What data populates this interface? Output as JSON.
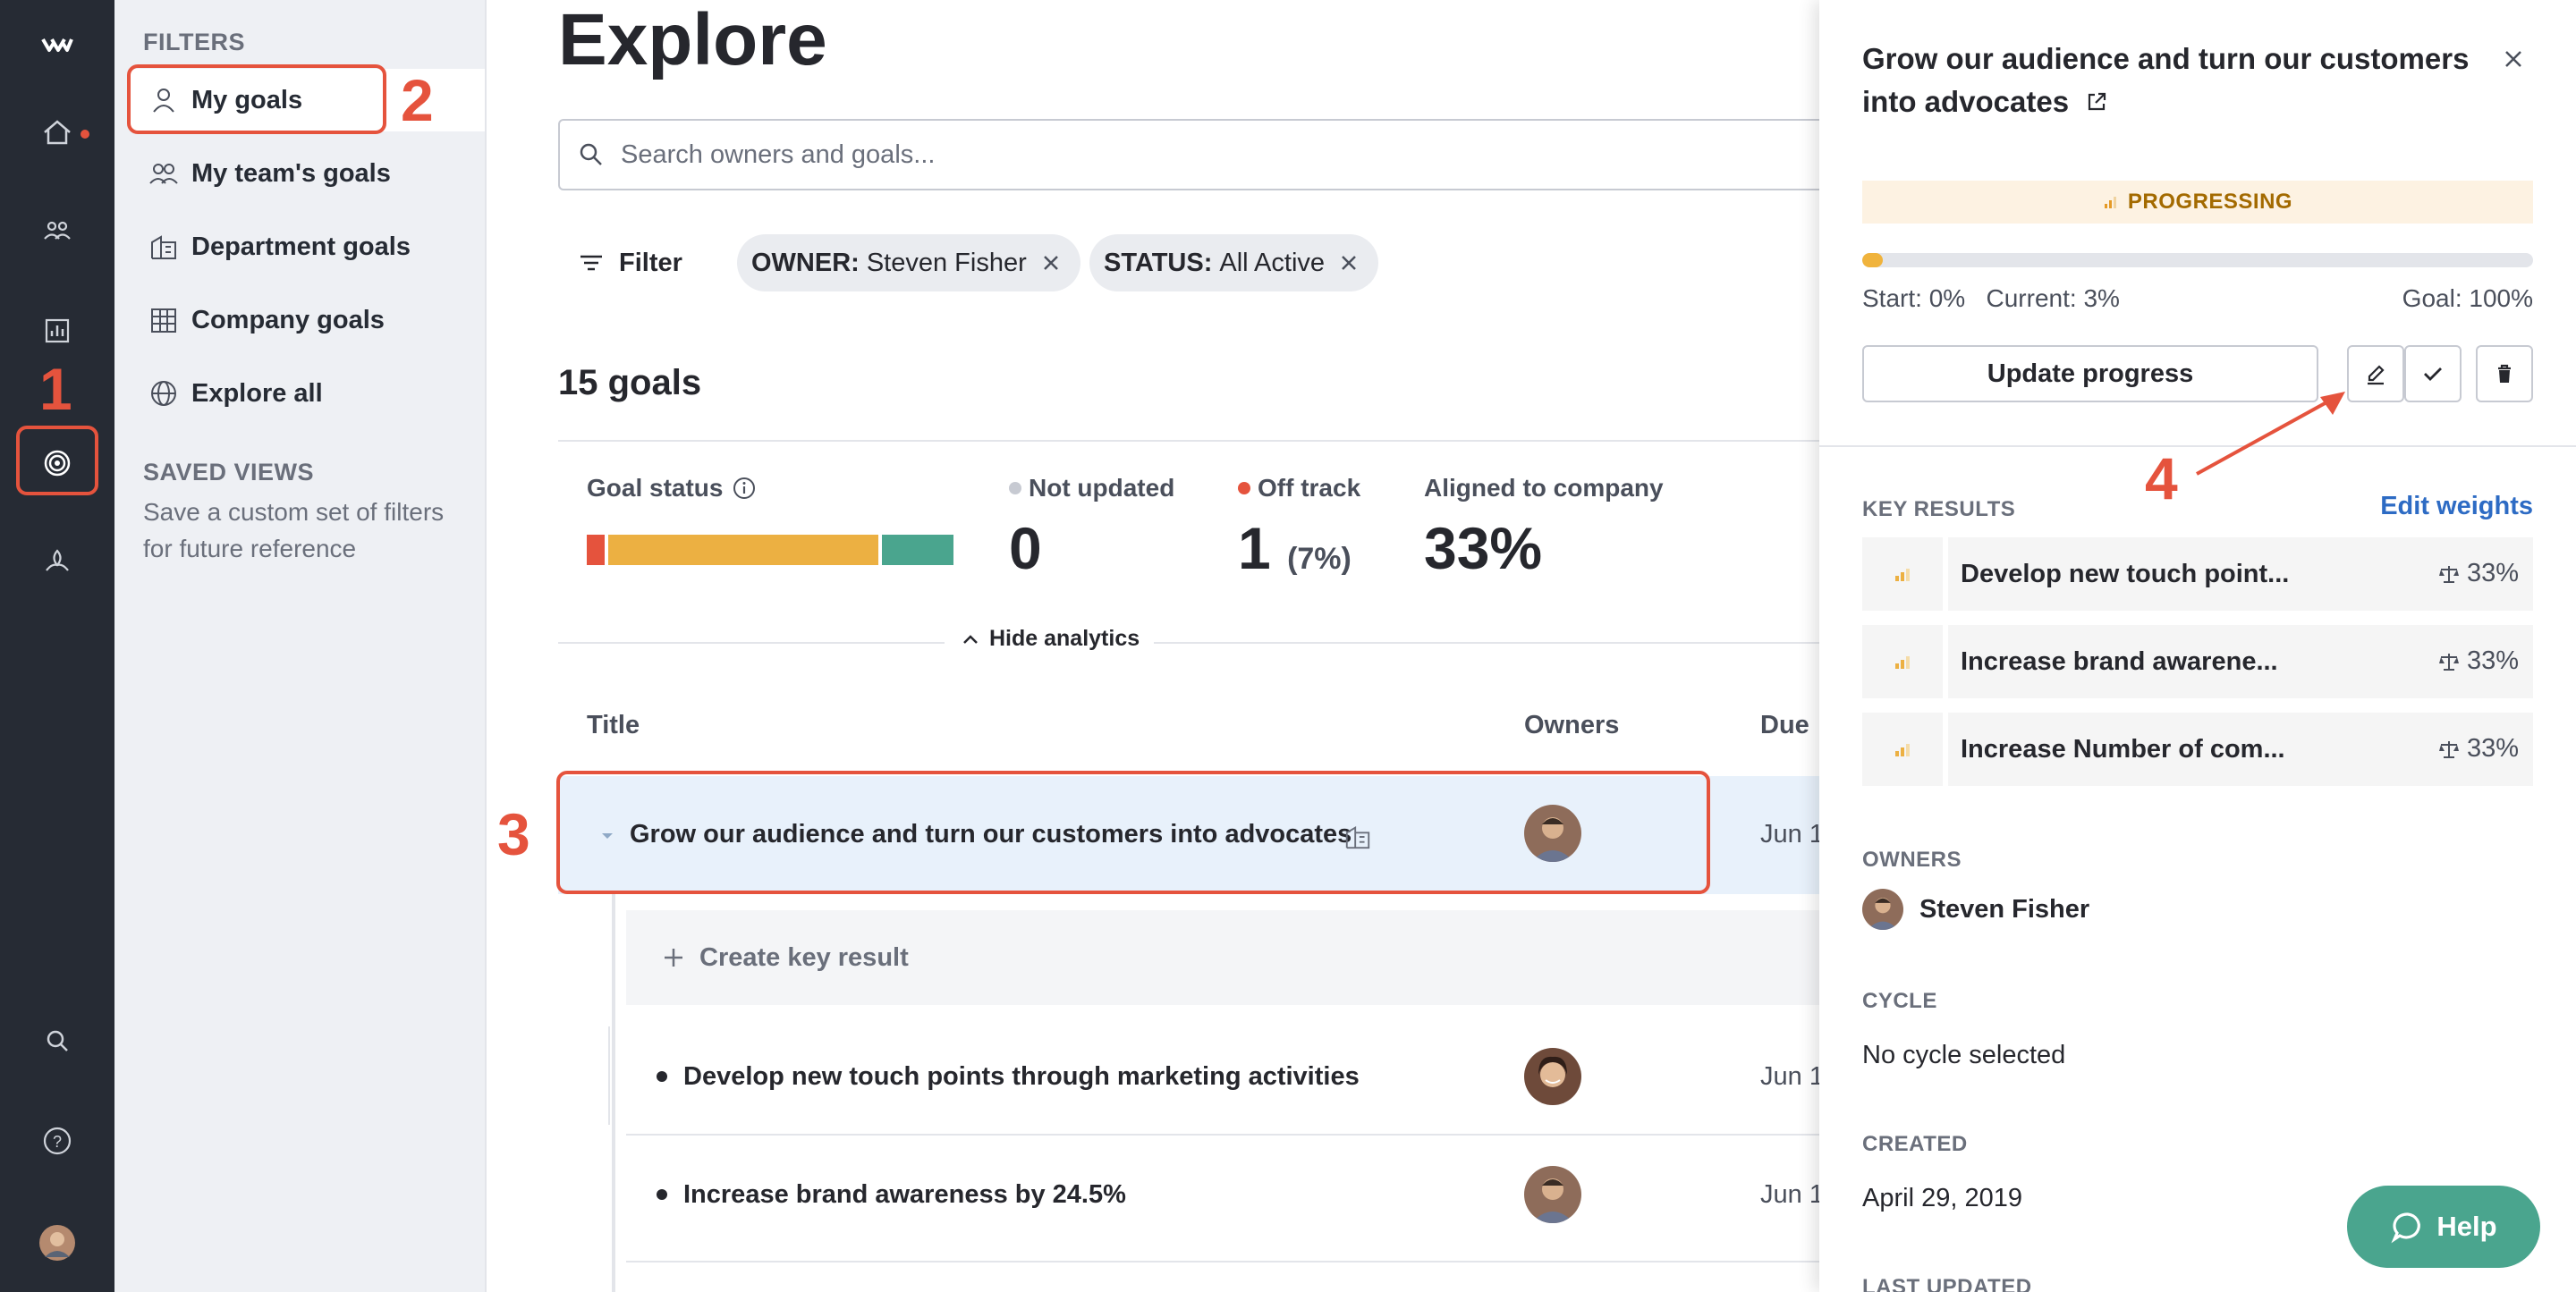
{
  "nav": {
    "items": [
      "home-icon",
      "team-icon",
      "analytics-icon",
      "goals-icon",
      "feedback-icon",
      "search-icon",
      "help-icon"
    ]
  },
  "filters": {
    "section_title": "FILTERS",
    "items": [
      {
        "label": "My goals",
        "icon": "person-icon",
        "active": true
      },
      {
        "label": "My team's goals",
        "icon": "people-icon"
      },
      {
        "label": "Department goals",
        "icon": "building-icon"
      },
      {
        "label": "Company goals",
        "icon": "office-icon"
      },
      {
        "label": "Explore all",
        "icon": "globe-icon"
      }
    ],
    "saved_views_title": "SAVED VIEWS",
    "saved_views_desc": "Save a custom set of filters for future reference"
  },
  "main": {
    "title": "Explore",
    "search_placeholder": "Search owners and goals...",
    "filter_label": "Filter",
    "chips": [
      {
        "key": "OWNER:",
        "value": "Steven Fisher"
      },
      {
        "key": "STATUS:",
        "value": "All Active"
      }
    ],
    "goals_count": "15 goals",
    "analytics": {
      "goal_status_label": "Goal status",
      "status_segments": [
        {
          "name": "off-track",
          "share": 0.05,
          "color": "#e5533d"
        },
        {
          "name": "progressing",
          "share": 0.75,
          "color": "#ecb042"
        },
        {
          "name": "on-track",
          "share": 0.2,
          "color": "#4aa58e"
        }
      ],
      "not_updated_label": "Not updated",
      "not_updated_value": "0",
      "off_track_label": "Off track",
      "off_track_value": "1",
      "off_track_pct": "(7%)",
      "aligned_label": "Aligned to company",
      "aligned_value": "33%",
      "hide_label": "Hide analytics"
    },
    "table": {
      "col_title": "Title",
      "col_owners": "Owners",
      "col_due": "Due",
      "rows": [
        {
          "title": "Grow our audience and turn our customers into advocates",
          "due": "Jun 1"
        },
        {
          "title": "Develop new touch points through marketing activities",
          "due": "Jun 1"
        },
        {
          "title": "Increase brand awareness by 24.5%",
          "due": "Jun 1"
        }
      ],
      "create_kr_label": "Create key result"
    }
  },
  "panel": {
    "title": "Grow our audience and turn our customers into advocates",
    "status": "PROGRESSING",
    "progress": 0.03,
    "start_label": "Start: 0%",
    "current_label": "Current: 3%",
    "goal_label": "Goal: 100%",
    "update_btn": "Update progress",
    "key_results_title": "KEY RESULTS",
    "edit_weights": "Edit weights",
    "key_results": [
      {
        "name": "Develop new touch point...",
        "weight": "33%"
      },
      {
        "name": "Increase brand awarene...",
        "weight": "33%"
      },
      {
        "name": "Increase Number of com...",
        "weight": "33%"
      }
    ],
    "owners_title": "OWNERS",
    "owner_name": "Steven Fisher",
    "cycle_title": "CYCLE",
    "cycle_value": "No cycle selected",
    "created_title": "CREATED",
    "created_value": "April 29, 2019",
    "last_updated_title": "LAST UPDATED"
  },
  "help_label": "Help",
  "annotations": [
    "1",
    "2",
    "3",
    "4"
  ],
  "colors": {
    "accent": "#e5533d",
    "link": "#2d6bc4",
    "help": "#4aa58e"
  }
}
